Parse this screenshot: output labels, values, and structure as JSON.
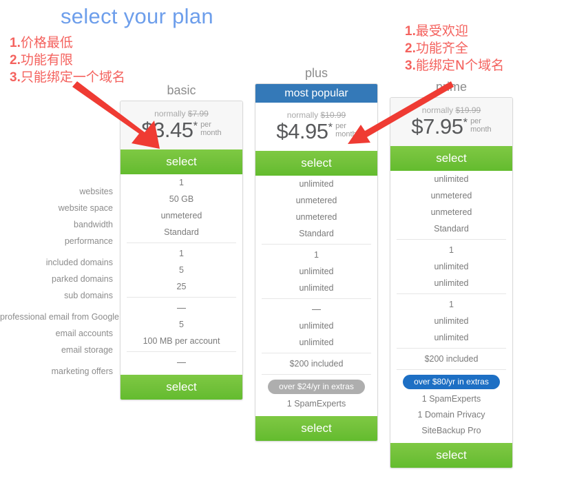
{
  "page": {
    "title": "select your plan",
    "title_color": "#6d9eeb"
  },
  "annotations": {
    "left": [
      {
        "num": "1.",
        "text": "价格最低"
      },
      {
        "num": "2.",
        "text": "功能有限"
      },
      {
        "num": "3.",
        "text": "只能绑定一个域名"
      }
    ],
    "right": [
      {
        "num": "1.",
        "text": "最受欢迎"
      },
      {
        "num": "2.",
        "text": "功能齐全"
      },
      {
        "num": "3.",
        "text": "能绑定N个域名"
      }
    ],
    "color": "#f4625e"
  },
  "feature_labels": [
    "websites",
    "website space",
    "bandwidth",
    "performance",
    "included domains",
    "parked domains",
    "sub domains",
    "professional email from Google",
    "email accounts",
    "email storage",
    "marketing offers"
  ],
  "plans": [
    {
      "id": "basic",
      "name": "basic",
      "badge": null,
      "normally_prefix": "normally",
      "normally_price": "$7.99",
      "price": "$3.45",
      "star": "*",
      "per": "per",
      "month": "month",
      "select_label": "select",
      "features": [
        "1",
        "50 GB",
        "unmetered",
        "Standard",
        "1",
        "5",
        "25",
        "—",
        "5",
        "100 MB per account",
        "—"
      ],
      "extras_pill": null,
      "extras": []
    },
    {
      "id": "plus",
      "name": "plus",
      "badge": "most popular",
      "normally_prefix": "normally",
      "normally_price": "$10.99",
      "price": "$4.95",
      "star": "*",
      "per": "per",
      "month": "month",
      "select_label": "select",
      "features": [
        "unlimited",
        "unmetered",
        "unmetered",
        "Standard",
        "1",
        "unlimited",
        "unlimited",
        "—",
        "unlimited",
        "unlimited",
        "$200 included"
      ],
      "extras_pill": "over $24/yr in extras",
      "extras_pill_color": "#aeaeae",
      "extras": [
        "1 SpamExperts"
      ]
    },
    {
      "id": "prime",
      "name": "prime",
      "badge": null,
      "normally_prefix": "normally",
      "normally_price": "$19.99",
      "price": "$7.95",
      "star": "*",
      "per": "per",
      "month": "month",
      "select_label": "select",
      "features": [
        "unlimited",
        "unmetered",
        "unmetered",
        "Standard",
        "1",
        "unlimited",
        "unlimited",
        "1",
        "unlimited",
        "unlimited",
        "$200 included"
      ],
      "extras_pill": "over $80/yr in extras",
      "extras_pill_color": "#1d6fc4",
      "extras": [
        "1 SpamExperts",
        "1 Domain Privacy",
        "SiteBackup Pro"
      ]
    }
  ],
  "colors": {
    "select_green": "#72c13a",
    "popular_blue": "#3479b8",
    "annotation_red": "#f4625e"
  }
}
